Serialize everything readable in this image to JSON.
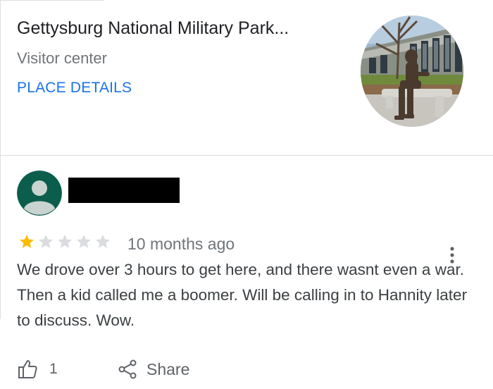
{
  "place": {
    "title": "Gettysburg National Military Park...",
    "type": "Visitor center",
    "details_link": "PLACE DETAILS",
    "photo_icon": "statue-photo"
  },
  "review": {
    "rating": 1,
    "max_rating": 5,
    "star_colors": {
      "filled": "#fbbc04",
      "empty": "#dadce0"
    },
    "time": "10 months ago",
    "text": "We drove over 3 hours to get here, and there wasnt even a war. Then a kid called me a boomer. Will be calling in to Hannity later to discuss. Wow.",
    "avatar_color": "#0b5e4c",
    "likes": "1",
    "share_label": "Share",
    "more_icon": "more-vert-icon"
  },
  "colors": {
    "link": "#1a73e8",
    "secondary_text": "#70757a"
  }
}
